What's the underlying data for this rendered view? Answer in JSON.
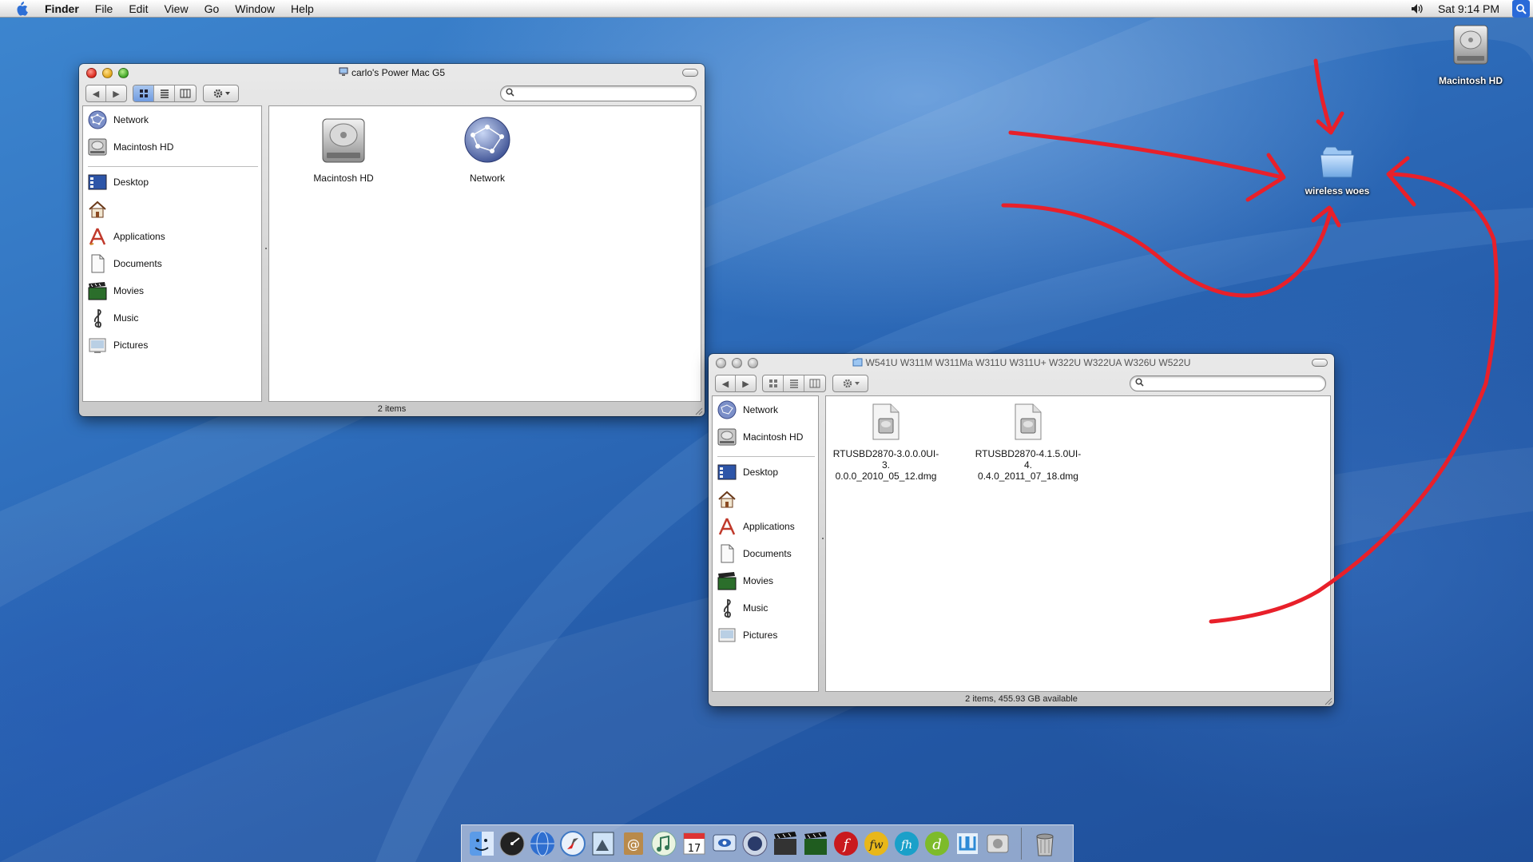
{
  "menubar": {
    "app_name": "Finder",
    "menus": [
      "File",
      "Edit",
      "View",
      "Go",
      "Window",
      "Help"
    ],
    "clock": "Sat 9:14 PM"
  },
  "desktop": {
    "hd_label": "Macintosh HD",
    "folder_label": "wireless woes"
  },
  "window1": {
    "title": "carlo's Power Mac G5",
    "sidebar": [
      "Network",
      "Macintosh HD",
      "Desktop",
      "",
      "Applications",
      "Documents",
      "Movies",
      "Music",
      "Pictures"
    ],
    "items": [
      "Macintosh HD",
      "Network"
    ],
    "status": "2 items"
  },
  "window2": {
    "title": "W541U W311M W311Ma W311U W311U+ W322U W322UA W326U W522U",
    "sidebar": [
      "Network",
      "Macintosh HD",
      "Desktop",
      "",
      "Applications",
      "Documents",
      "Movies",
      "Music",
      "Pictures"
    ],
    "files": [
      {
        "line1": "RTUSBD2870-3.0.0.0UI-3.",
        "line2": "0.0.0_2010_05_12.dmg"
      },
      {
        "line1": "RTUSBD2870-4.1.5.0UI-4.",
        "line2": "0.4.0_2011_07_18.dmg"
      }
    ],
    "status": "2 items, 455.93 GB available"
  },
  "colors": {
    "annotation": "#e8202a",
    "selection": "#6f9be0"
  },
  "icons": [
    "apple-icon",
    "volume-icon",
    "spotlight-icon",
    "hard-drive-icon",
    "folder-icon",
    "network-icon",
    "desktop-icon",
    "home-icon",
    "applications-icon",
    "documents-icon",
    "movies-icon",
    "music-icon",
    "pictures-icon",
    "dmg-file-icon",
    "trash-icon"
  ]
}
